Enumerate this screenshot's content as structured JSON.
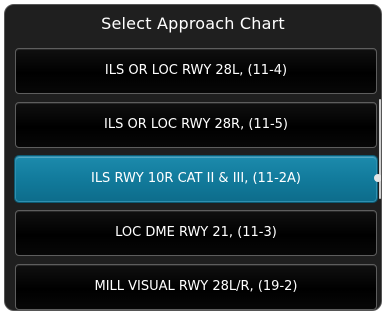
{
  "dialog": {
    "title": "Select Approach Chart"
  },
  "charts": [
    {
      "label": "ILS OR LOC RWY 28L, (11-4)",
      "selected": false
    },
    {
      "label": "ILS OR LOC RWY 28R, (11-5)",
      "selected": false
    },
    {
      "label": "ILS RWY 10R CAT II & III, (11-2A)",
      "selected": true
    },
    {
      "label": "LOC DME RWY 21, (11-3)",
      "selected": false
    },
    {
      "label": "MILL VISUAL RWY 28L/R, (19-2)",
      "selected": false
    }
  ],
  "colors": {
    "background": "#1f1f1f",
    "item_background": "#000000",
    "selected_background": "#127b9c",
    "text": "#ffffff"
  }
}
